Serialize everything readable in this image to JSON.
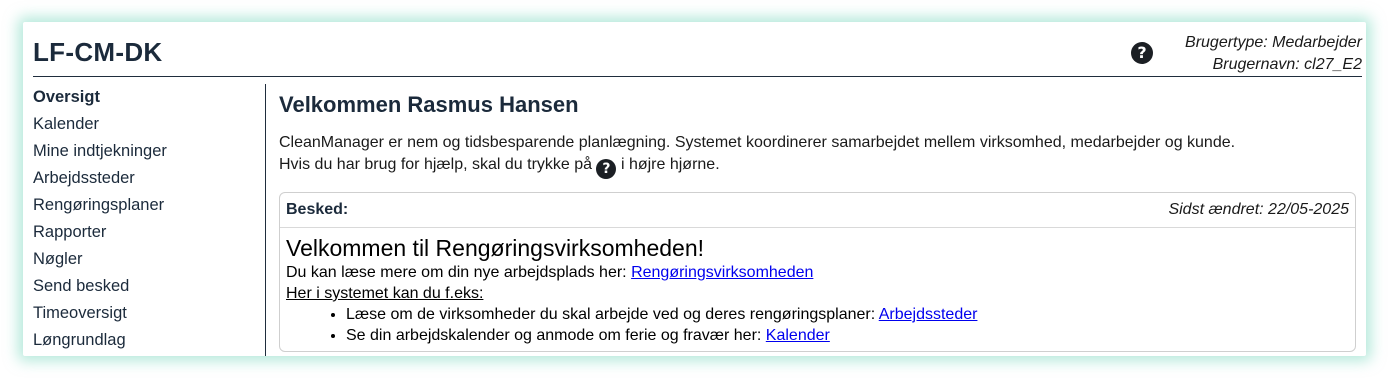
{
  "header": {
    "app_title": "LF-CM-DK",
    "help_icon": "question-circle-icon",
    "user_type": "Brugertype: Medarbejder",
    "username": "Brugernavn: cl27_E2"
  },
  "sidebar": {
    "items": [
      {
        "label": "Oversigt",
        "active": true
      },
      {
        "label": "Kalender"
      },
      {
        "label": "Mine indtjekninger"
      },
      {
        "label": "Arbejdssteder"
      },
      {
        "label": "Rengøringsplaner"
      },
      {
        "label": "Rapporter"
      },
      {
        "label": "Nøgler"
      },
      {
        "label": "Send besked"
      },
      {
        "label": "Timeoversigt"
      },
      {
        "label": "Løngrundlag"
      }
    ]
  },
  "main": {
    "title": "Velkommen Rasmus Hansen",
    "intro_line1": "CleanManager er nem og tidsbesparende planlægning. Systemet koordinerer samarbejdet mellem virksomhed, medarbejder og kunde.",
    "intro_line2_pre": "Hvis du har brug for hjælp, skal du trykke på",
    "intro_line2_post": "i højre hjørne."
  },
  "message": {
    "label": "Besked:",
    "last_changed": "Sidst ændret: 22/05-2025",
    "heading": "Velkommen til Rengøringsvirksomheden!",
    "line1_text": "Du kan læse mere om din nye arbejdsplads her:",
    "line1_link": "Rengøringsvirksomheden",
    "line2": "Her i systemet kan du f.eks:",
    "bullets": [
      {
        "text": "Læse om de virksomheder du skal arbejde ved og deres rengøringsplaner:",
        "link": "Arbejdssteder "
      },
      {
        "text": "Se din arbejdskalender og anmode om ferie og fravær her:",
        "link": "Kalender"
      }
    ]
  },
  "colors": {
    "title": "#1b2a3b",
    "link": "#0000ee",
    "frame_glow": "#78d7be"
  }
}
